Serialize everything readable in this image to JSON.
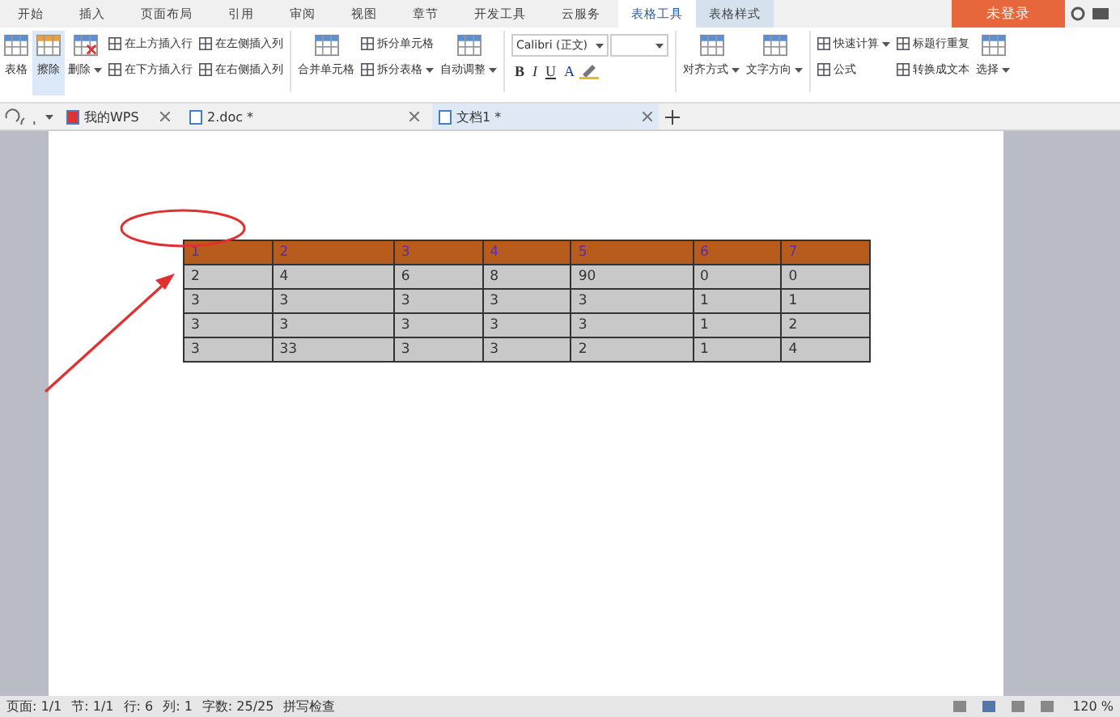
{
  "menu_tabs": [
    {
      "label": "开始",
      "selected": false
    },
    {
      "label": "插入",
      "selected": false
    },
    {
      "label": "页面布局",
      "selected": false
    },
    {
      "label": "引用",
      "selected": false
    },
    {
      "label": "审阅",
      "selected": false
    },
    {
      "label": "视图",
      "selected": false
    },
    {
      "label": "章节",
      "selected": false
    },
    {
      "label": "开发工具",
      "selected": false
    },
    {
      "label": "云服务",
      "selected": false
    },
    {
      "label": "表格工具",
      "selected": true
    },
    {
      "label": "表格样式",
      "selected": false
    }
  ],
  "login_button": "未登录",
  "ribbon": [
    {
      "kind": "large",
      "label": "表格",
      "selected": false,
      "dropdown": false
    },
    {
      "kind": "large",
      "label": "擦除",
      "selected": true,
      "dropdown": false
    },
    {
      "kind": "large",
      "label": "删除",
      "selected": false,
      "dropdown": true
    },
    {
      "kind": "stack",
      "items": [
        {
          "label": "在上方插入行",
          "dropdown": false
        },
        {
          "label": "在下方插入行",
          "dropdown": false
        }
      ]
    },
    {
      "kind": "stack",
      "items": [
        {
          "label": "在左侧插入列",
          "dropdown": false
        },
        {
          "label": "在右侧插入列",
          "dropdown": false
        }
      ]
    },
    {
      "kind": "divider"
    },
    {
      "kind": "large",
      "label": "合并单元格",
      "selected": false,
      "dropdown": false
    },
    {
      "kind": "stack",
      "items": [
        {
          "label": "拆分单元格",
          "dropdown": false
        },
        {
          "label": "拆分表格",
          "dropdown": true
        }
      ]
    },
    {
      "kind": "large",
      "label": "自动调整",
      "selected": false,
      "dropdown": true
    },
    {
      "kind": "divider"
    },
    {
      "kind": "font",
      "font": "Calibri (正文)",
      "buttons": [
        "B",
        "I",
        "U",
        "A"
      ]
    },
    {
      "kind": "divider"
    },
    {
      "kind": "large",
      "label": "对齐方式",
      "selected": false,
      "dropdown": true
    },
    {
      "kind": "large",
      "label": "文字方向",
      "selected": false,
      "dropdown": true
    },
    {
      "kind": "divider"
    },
    {
      "kind": "stack",
      "items": [
        {
          "label": "快速计算",
          "dropdown": true
        },
        {
          "label": "公式",
          "dropdown": false
        }
      ]
    },
    {
      "kind": "stack",
      "items": [
        {
          "label": "标题行重复",
          "dropdown": false
        },
        {
          "label": "转换成文本",
          "dropdown": false
        }
      ]
    },
    {
      "kind": "large",
      "label": "选择",
      "selected": false,
      "dropdown": true
    }
  ],
  "doc_tabs": [
    {
      "label": "我的WPS",
      "selected": false
    },
    {
      "label": "2.doc *",
      "selected": false
    },
    {
      "label": "文档1 *",
      "selected": true
    }
  ],
  "table": {
    "header": [
      "1",
      "2",
      "3",
      "4",
      "5",
      "6",
      "7"
    ],
    "rows": [
      [
        "2",
        "4",
        "6",
        "8",
        "90",
        "0",
        "0"
      ],
      [
        "3",
        "3",
        "3",
        "3",
        "3",
        "1",
        "1"
      ],
      [
        "3",
        "3",
        "3",
        "3",
        "3",
        "1",
        "2"
      ],
      [
        "3",
        "33",
        "3",
        "3",
        "2",
        "1",
        "4"
      ]
    ]
  },
  "status_bar": {
    "items": [
      "页面: 1/1",
      "节: 1/1",
      "行: 6",
      "列: 1",
      "字数: 25/25",
      "拼写检查"
    ],
    "zoom": "120 %"
  }
}
